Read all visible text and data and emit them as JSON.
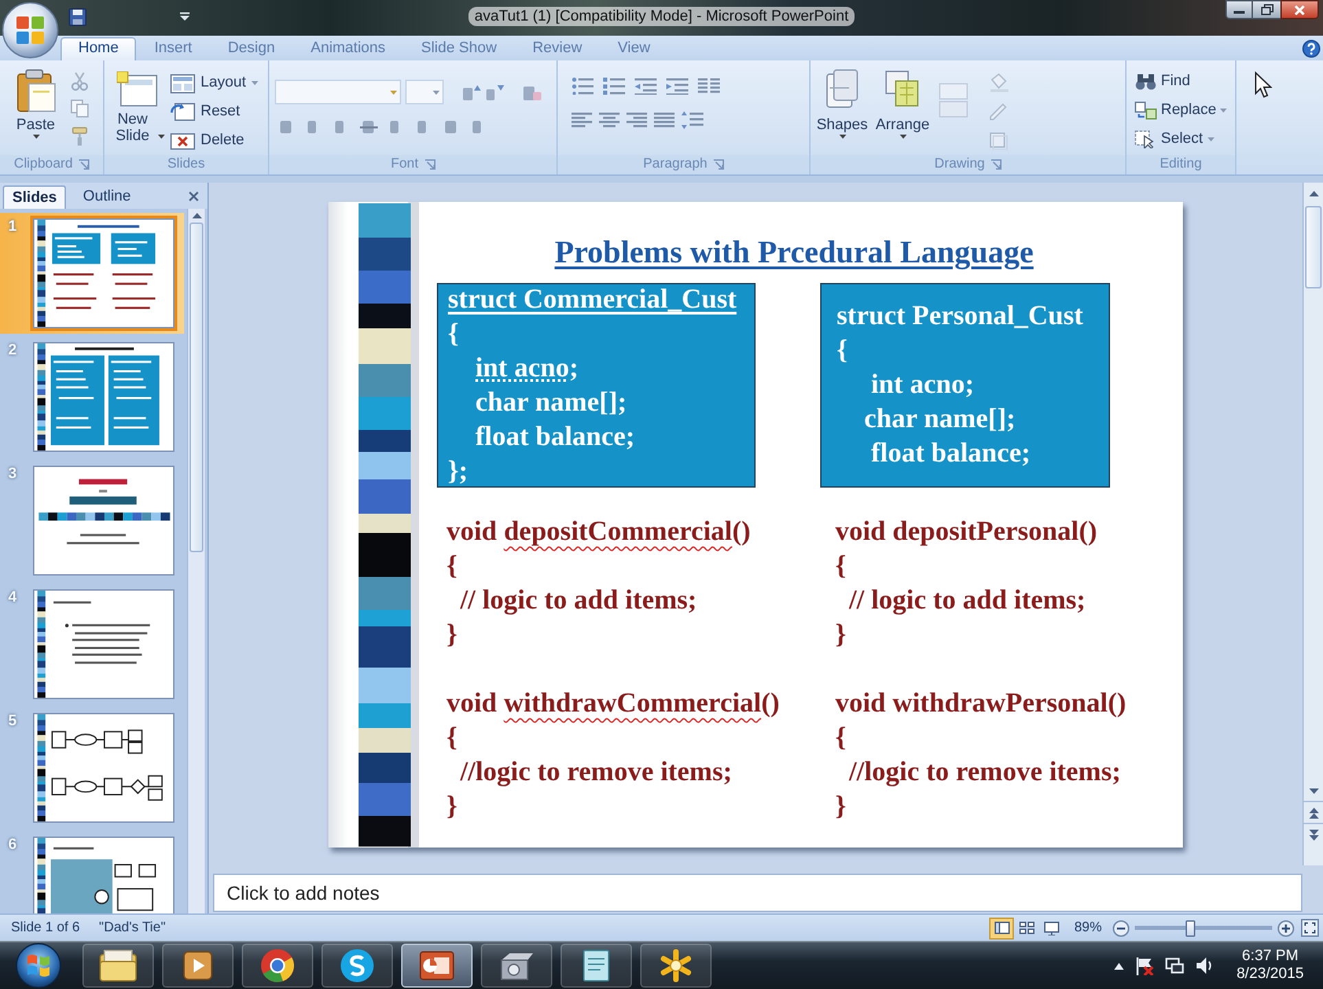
{
  "window": {
    "title": "avaTut1 (1) [Compatibility Mode] - Microsoft PowerPoint"
  },
  "ribbon": {
    "tabs": [
      {
        "label": "Home",
        "selected": true
      },
      {
        "label": "Insert",
        "selected": false
      },
      {
        "label": "Design",
        "selected": false
      },
      {
        "label": "Animations",
        "selected": false
      },
      {
        "label": "Slide Show",
        "selected": false
      },
      {
        "label": "Review",
        "selected": false
      },
      {
        "label": "View",
        "selected": false
      }
    ],
    "clipboard": {
      "label": "Clipboard",
      "paste": "Paste"
    },
    "slides": {
      "label": "Slides",
      "new_slide": "New Slide",
      "commands": [
        {
          "label": "Layout",
          "kind": "layout"
        },
        {
          "label": "Reset",
          "kind": "reset"
        },
        {
          "label": "Delete",
          "kind": "delete"
        }
      ]
    },
    "font": {
      "label": "Font"
    },
    "paragraph": {
      "label": "Paragraph"
    },
    "drawing": {
      "label": "Drawing",
      "shapes": "Shapes",
      "arrange": "Arrange"
    },
    "editing": {
      "label": "Editing",
      "commands": [
        {
          "label": "Find",
          "kind": "find"
        },
        {
          "label": "Replace",
          "kind": "replace"
        },
        {
          "label": "Select",
          "kind": "select"
        }
      ]
    }
  },
  "slides_pane": {
    "tabs": [
      {
        "label": "Slides",
        "selected": true
      },
      {
        "label": "Outline",
        "selected": false
      }
    ],
    "thumbnails": [
      {
        "number": "1",
        "kind": "code",
        "selected": true
      },
      {
        "number": "2",
        "kind": "columns",
        "selected": false
      },
      {
        "number": "3",
        "kind": "title",
        "selected": false
      },
      {
        "number": "4",
        "kind": "bullets",
        "selected": false
      },
      {
        "number": "5",
        "kind": "diagram",
        "selected": false
      },
      {
        "number": "6",
        "kind": "panel",
        "selected": false
      }
    ]
  },
  "slide": {
    "title": "Problems with Prcedural Language",
    "columns": [
      {
        "box": [
          [
            {
              "text": "struct Commercial_Cust",
              "kind": "underline"
            }
          ],
          "{",
          [
            {
              "text": "    int acno",
              "kind": "dotted"
            },
            {
              "text": ";",
              "kind": "plain"
            }
          ],
          "    char name[];",
          "    float balance;",
          "};"
        ],
        "functions": [
          [
            [
              {
                "text": "void ",
                "kind": "plain"
              },
              {
                "text": "depositCommercial",
                "kind": "wavy"
              },
              {
                "text": "()",
                "kind": "plain"
              }
            ],
            "{",
            "  // logic to add items;",
            "}"
          ],
          [
            [
              {
                "text": "void ",
                "kind": "plain"
              },
              {
                "text": "withdrawCommercial",
                "kind": "wavy"
              },
              {
                "text": "()",
                "kind": "plain"
              }
            ],
            "{",
            "  //logic to remove items;",
            "}"
          ]
        ]
      },
      {
        "box": [
          "struct Personal_Cust",
          "{",
          "     int acno;",
          "    char name[];",
          "     float balance;"
        ],
        "functions": [
          [
            "void depositPersonal()",
            "{",
            "  // logic to add items;",
            "}"
          ],
          [
            "void withdrawPersonal()",
            "{",
            "  //logic to remove items;",
            "}"
          ]
        ]
      }
    ]
  },
  "notes": {
    "placeholder": "Click to add notes"
  },
  "status_bar": {
    "slide_info": "Slide 1 of 6",
    "theme": "\"Dad's Tie\"",
    "zoom": "89%",
    "zoom_slider": {
      "level": 0.4
    }
  },
  "taskbar": {
    "apps": [
      {
        "kind": "folder",
        "active": false
      },
      {
        "kind": "media",
        "active": false
      },
      {
        "kind": "browser",
        "active": false
      },
      {
        "kind": "chat",
        "active": false
      },
      {
        "kind": "presentation",
        "active": true
      },
      {
        "kind": "drive",
        "active": false
      },
      {
        "kind": "notepad",
        "active": false
      },
      {
        "kind": "asterisk",
        "active": false
      }
    ],
    "clock": {
      "time": "6:37 PM",
      "date": "8/23/2015"
    }
  }
}
